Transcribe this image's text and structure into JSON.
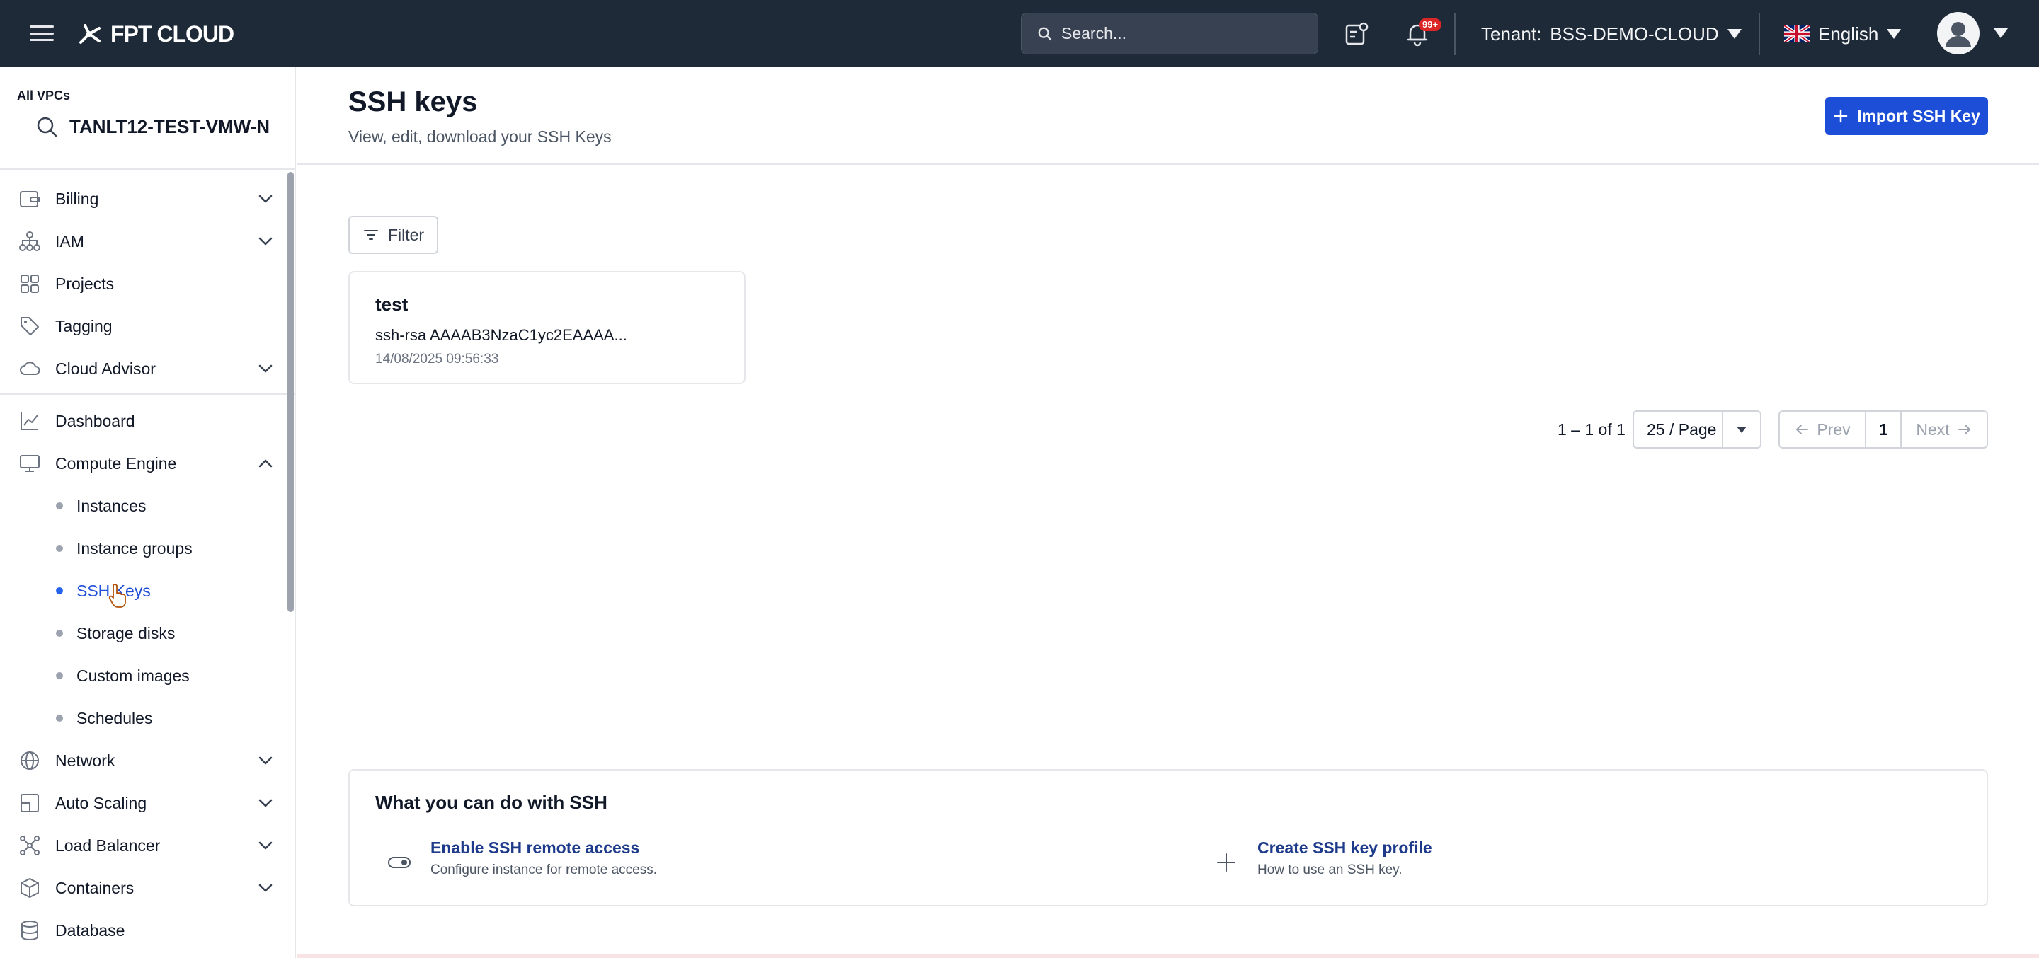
{
  "header": {
    "logo_text": "FPT CLOUD",
    "search_placeholder": "Search...",
    "notification_badge": "99+",
    "tenant_label": "Tenant:",
    "tenant_value": "BSS-DEMO-CLOUD",
    "language": "English"
  },
  "sidebar": {
    "vpc_label": "All VPCs",
    "vpc_name": "TANLT12-TEST-VMW-N",
    "items": {
      "billing": "Billing",
      "iam": "IAM",
      "projects": "Projects",
      "tagging": "Tagging",
      "cloud_advisor": "Cloud Advisor",
      "dashboard": "Dashboard",
      "compute_engine": "Compute Engine",
      "network": "Network",
      "auto_scaling": "Auto Scaling",
      "load_balancer": "Load Balancer",
      "containers": "Containers",
      "database": "Database"
    },
    "compute_sub": {
      "instances": "Instances",
      "instance_groups": "Instance groups",
      "ssh_keys": "SSH Keys",
      "storage_disks": "Storage disks",
      "custom_images": "Custom images",
      "schedules": "Schedules"
    },
    "active_item": "SSH Keys"
  },
  "main": {
    "title": "SSH keys",
    "subtitle": "View, edit, download your SSH Keys",
    "import_button": "Import SSH Key",
    "filter_button": "Filter",
    "keys": [
      {
        "name": "test",
        "value": "ssh-rsa AAAAB3NzaC1yc2EAAAA...",
        "date": "14/08/2025 09:56:33"
      }
    ],
    "pagination": {
      "range": "1 – 1 of 1",
      "page_size": "25 / Page",
      "prev": "Prev",
      "current_page": "1",
      "next": "Next"
    },
    "what_panel": {
      "title": "What you can do with SSH",
      "features": [
        {
          "title": "Enable SSH remote access",
          "desc": "Configure instance for remote access."
        },
        {
          "title": "Create SSH key profile",
          "desc": "How to use an SSH key."
        }
      ]
    }
  },
  "colors": {
    "header_bg": "#1e2a38",
    "primary": "#1d4ed8",
    "active_link": "#1d4ed8",
    "badge": "#dc2626"
  }
}
